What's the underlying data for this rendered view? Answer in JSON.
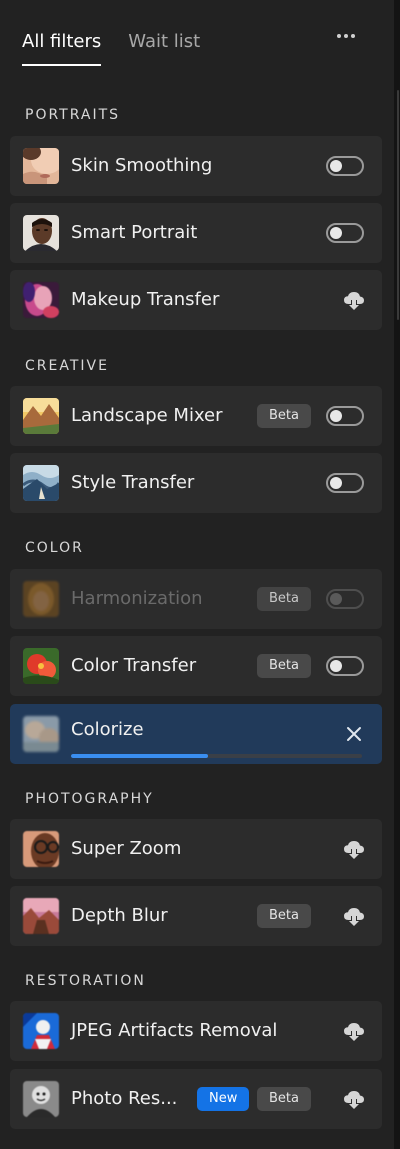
{
  "tabs": [
    {
      "label": "All filters",
      "active": true
    },
    {
      "label": "Wait list",
      "active": false
    }
  ],
  "more_icon": "more-horizontal-icon",
  "colors": {
    "background": "#222222",
    "row": "#2c2c2c",
    "active_row": "#213a5a",
    "accent": "#1473e6",
    "progress": "#3a8ef0"
  },
  "sections": [
    {
      "title": "PORTRAITS",
      "items": [
        {
          "label": "Skin Smoothing",
          "control": "toggle",
          "on": false
        },
        {
          "label": "Smart Portrait",
          "control": "toggle",
          "on": false
        },
        {
          "label": "Makeup Transfer",
          "control": "download",
          "icon": "cloud-download-icon"
        }
      ]
    },
    {
      "title": "CREATIVE",
      "items": [
        {
          "label": "Landscape Mixer",
          "badge": "Beta",
          "control": "toggle",
          "on": false
        },
        {
          "label": "Style Transfer",
          "control": "toggle",
          "on": false
        }
      ]
    },
    {
      "title": "COLOR",
      "items": [
        {
          "label": "Harmonization",
          "badge": "Beta",
          "control": "toggle",
          "on": false,
          "disabled": true
        },
        {
          "label": "Color Transfer",
          "badge": "Beta",
          "control": "toggle",
          "on": false
        },
        {
          "label": "Colorize",
          "control": "downloading",
          "progress": 0.47,
          "icon": "close-icon"
        }
      ]
    },
    {
      "title": "PHOTOGRAPHY",
      "items": [
        {
          "label": "Super Zoom",
          "control": "download",
          "icon": "cloud-download-icon"
        },
        {
          "label": "Depth Blur",
          "badge": "Beta",
          "control": "download",
          "icon": "cloud-download-icon"
        }
      ]
    },
    {
      "title": "RESTORATION",
      "items": [
        {
          "label": "JPEG Artifacts Removal",
          "control": "download",
          "icon": "cloud-download-icon"
        },
        {
          "label": "Photo Res...",
          "new_badge": "New",
          "badge": "Beta",
          "control": "download",
          "icon": "cloud-download-icon"
        }
      ]
    }
  ]
}
